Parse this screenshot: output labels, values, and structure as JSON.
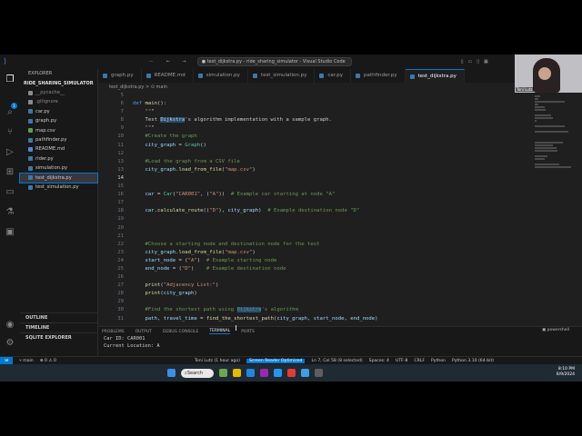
{
  "titlebar": {
    "search_text": "● test_dijkstra.py - ride_sharing_simulator - Visual Studio Code"
  },
  "sidebar": {
    "title": "EXPLORER",
    "project": "RIDE_SHARING_SIMULATOR",
    "badge": "1",
    "files": [
      {
        "name": "__pycache__",
        "color": "#8a8a8a"
      },
      {
        "name": ".gitignore",
        "color": "#8a8a8a"
      },
      {
        "name": "car.py",
        "color": "#3c78aa"
      },
      {
        "name": "graph.py",
        "color": "#3c78aa"
      },
      {
        "name": "map.csv",
        "color": "#5aa05a"
      },
      {
        "name": "pathfinder.py",
        "color": "#3c78aa"
      },
      {
        "name": "README.md",
        "color": "#4a8ad6"
      },
      {
        "name": "rider.py",
        "color": "#3c78aa"
      },
      {
        "name": "simulation.py",
        "color": "#3c78aa"
      },
      {
        "name": "test_dijkstra.py",
        "color": "#3c78aa"
      },
      {
        "name": "test_simulation.py",
        "color": "#3c78aa"
      }
    ],
    "outline": "OUTLINE",
    "timeline": "TIMELINE",
    "sqlite": "SQLITE EXPLORER"
  },
  "tabs": [
    "graph.py",
    "README.md",
    "simulation.py",
    "test_simulation.py",
    "car.py",
    "pathfinder.py",
    "test_dijkstra.py"
  ],
  "breadcrumb": "test_dijkstra.py > ⊙ main",
  "editor": {
    "lines": [
      {
        "n": "5",
        "t": ""
      },
      {
        "n": "6",
        "t": "def main():"
      },
      {
        "n": "7",
        "t": "    \"\"\""
      },
      {
        "n": "8",
        "t": "    Test Dijkstra's algorithm implementation with a sample graph."
      },
      {
        "n": "9",
        "t": "    \"\"\""
      },
      {
        "n": "10",
        "t": "    #Create the graph"
      },
      {
        "n": "11",
        "t": "    city_graph = Graph()"
      },
      {
        "n": "12",
        "t": ""
      },
      {
        "n": "13",
        "t": "    #Load the graph from a CSV file"
      },
      {
        "n": "13",
        "t": "    city_graph.load_from_file(\"map.csv\")"
      },
      {
        "n": "14",
        "t": "    "
      },
      {
        "n": "15",
        "t": ""
      },
      {
        "n": "16",
        "t": "    car = Car(\"CAR001\", (\"A\"))  # Example car starting at node \"A\""
      },
      {
        "n": "17",
        "t": ""
      },
      {
        "n": "18",
        "t": "    car.calculate_route((\"D\"), city_graph)  # Example destination node \"D\""
      },
      {
        "n": "19",
        "t": ""
      },
      {
        "n": "20",
        "t": ""
      },
      {
        "n": "21",
        "t": ""
      },
      {
        "n": "22",
        "t": "    #Choose a starting node and destination node for the test"
      },
      {
        "n": "23",
        "t": "    city_graph.load_from_file(\"map.csv\")"
      },
      {
        "n": "24",
        "t": "    start_node = (\"A\")  # Example starting node"
      },
      {
        "n": "25",
        "t": "    end_node = (\"D\")    # Example destination node"
      },
      {
        "n": "26",
        "t": ""
      },
      {
        "n": "27",
        "t": "    print(\"Adjacency List:\")"
      },
      {
        "n": "28",
        "t": "    print(city_graph)"
      },
      {
        "n": "29",
        "t": ""
      },
      {
        "n": "30",
        "t": "    #Find the shortest path using Dijkstra's algorithm"
      },
      {
        "n": "31",
        "t": "    path, travel_time = find_the_shortest_path(city_graph, start_node, end_node)"
      }
    ],
    "current_line": "14"
  },
  "panel": {
    "tabs": [
      "PROBLEMS",
      "OUTPUT",
      "DEBUG CONSOLE",
      "TERMINAL",
      "PORTS"
    ],
    "active_tab": "TERMINAL",
    "shell": "powershell",
    "terminal_lines": [
      "Car ID: CAR001",
      "Current Location: A"
    ]
  },
  "statusbar": {
    "branch": "main",
    "errors": "⊗ 0 ⚠ 0",
    "git": "Toni Lutz (1 hour ago)",
    "screen_reader": "Screen Reader Optimized",
    "position": "Ln 7, Col 58 (8 selected)",
    "spaces": "Spaces: 4",
    "encoding": "UTF-8",
    "eol": "CRLF",
    "language": "Python",
    "interpreter": "Python 3.10 (64-bit)"
  },
  "taskbar": {
    "search": "Search",
    "time": "8:10 PM",
    "date": "6/9/2024"
  },
  "webcam": {
    "name": "Toni Lutz"
  }
}
